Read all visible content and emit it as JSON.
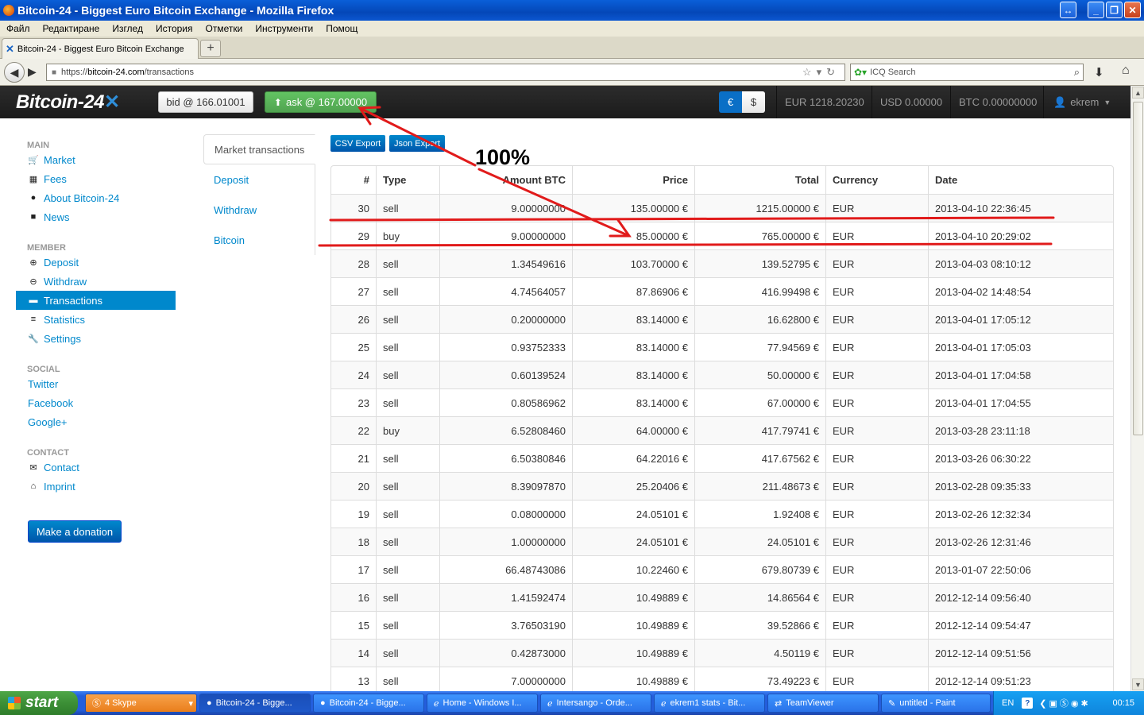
{
  "window": {
    "title": "Bitcoin-24 - Biggest Euro Bitcoin Exchange - Mozilla Firefox"
  },
  "menu": [
    "Файл",
    "Редактиране",
    "Изглед",
    "История",
    "Отметки",
    "Инструменти",
    "Помощ"
  ],
  "browser": {
    "tab_title": "Bitcoin-24 - Biggest Euro Bitcoin Exchange",
    "url_prefix": "https://",
    "url_domain": "bitcoin-24.com",
    "url_path": "/transactions",
    "search_placeholder": "ICQ Search"
  },
  "site": {
    "logo_text": "Bitcoin-24",
    "bid_label": "bid @ 166.01001",
    "ask_label": "ask @ 167.00000",
    "currency_eur": "€",
    "currency_usd": "$",
    "balance_eur": "EUR 1218.20230",
    "balance_usd": "USD 0.00000",
    "balance_btc": "BTC 0.00000000",
    "username": "ekrem"
  },
  "sidebar": {
    "main_header": "MAIN",
    "main_items": [
      "Market",
      "Fees",
      "About Bitcoin-24",
      "News"
    ],
    "member_header": "MEMBER",
    "member_items": [
      "Deposit",
      "Withdraw",
      "Transactions",
      "Statistics",
      "Settings"
    ],
    "social_header": "SOCIAL",
    "social_items": [
      "Twitter",
      "Facebook",
      "Google+"
    ],
    "contact_header": "CONTACT",
    "contact_items": [
      "Contact",
      "Imprint"
    ],
    "donate_label": "Make a donation"
  },
  "subnav": [
    "Market transactions",
    "Deposit",
    "Withdraw",
    "Bitcoin"
  ],
  "exports": {
    "csv": "CSV Export",
    "json": "Json Export"
  },
  "table": {
    "headers": [
      "#",
      "Type",
      "Amount BTC",
      "Price",
      "Total",
      "Currency",
      "Date"
    ],
    "rows": [
      [
        "30",
        "sell",
        "9.00000000",
        "135.00000 €",
        "1215.00000 €",
        "EUR",
        "2013-04-10 22:36:45"
      ],
      [
        "29",
        "buy",
        "9.00000000",
        "85.00000 €",
        "765.00000 €",
        "EUR",
        "2013-04-10 20:29:02"
      ],
      [
        "28",
        "sell",
        "1.34549616",
        "103.70000 €",
        "139.52795 €",
        "EUR",
        "2013-04-03 08:10:12"
      ],
      [
        "27",
        "sell",
        "4.74564057",
        "87.86906 €",
        "416.99498 €",
        "EUR",
        "2013-04-02 14:48:54"
      ],
      [
        "26",
        "sell",
        "0.20000000",
        "83.14000 €",
        "16.62800 €",
        "EUR",
        "2013-04-01 17:05:12"
      ],
      [
        "25",
        "sell",
        "0.93752333",
        "83.14000 €",
        "77.94569 €",
        "EUR",
        "2013-04-01 17:05:03"
      ],
      [
        "24",
        "sell",
        "0.60139524",
        "83.14000 €",
        "50.00000 €",
        "EUR",
        "2013-04-01 17:04:58"
      ],
      [
        "23",
        "sell",
        "0.80586962",
        "83.14000 €",
        "67.00000 €",
        "EUR",
        "2013-04-01 17:04:55"
      ],
      [
        "22",
        "buy",
        "6.52808460",
        "64.00000 €",
        "417.79741 €",
        "EUR",
        "2013-03-28 23:11:18"
      ],
      [
        "21",
        "sell",
        "6.50380846",
        "64.22016 €",
        "417.67562 €",
        "EUR",
        "2013-03-26 06:30:22"
      ],
      [
        "20",
        "sell",
        "8.39097870",
        "25.20406 €",
        "211.48673 €",
        "EUR",
        "2013-02-28 09:35:33"
      ],
      [
        "19",
        "sell",
        "0.08000000",
        "24.05101 €",
        "1.92408 €",
        "EUR",
        "2013-02-26 12:32:34"
      ],
      [
        "18",
        "sell",
        "1.00000000",
        "24.05101 €",
        "24.05101 €",
        "EUR",
        "2013-02-26 12:31:46"
      ],
      [
        "17",
        "sell",
        "66.48743086",
        "10.22460 €",
        "679.80739 €",
        "EUR",
        "2013-01-07 22:50:06"
      ],
      [
        "16",
        "sell",
        "1.41592474",
        "10.49889 €",
        "14.86564 €",
        "EUR",
        "2012-12-14 09:56:40"
      ],
      [
        "15",
        "sell",
        "3.76503190",
        "10.49889 €",
        "39.52866 €",
        "EUR",
        "2012-12-14 09:54:47"
      ],
      [
        "14",
        "sell",
        "0.42873000",
        "10.49889 €",
        "4.50119 €",
        "EUR",
        "2012-12-14 09:51:56"
      ],
      [
        "13",
        "sell",
        "7.00000000",
        "10.49889 €",
        "73.49223 €",
        "EUR",
        "2012-12-14 09:51:23"
      ]
    ]
  },
  "annotation": {
    "label": "100%",
    "color": "#e11b1b"
  },
  "taskbar": {
    "start_label": "start",
    "items": [
      "4 Skype",
      "Bitcoin-24 - Bigge...",
      "Bitcoin-24 - Bigge...",
      "Home - Windows I...",
      "Intersango - Orde...",
      "ekrem1 stats - Bit...",
      "TeamViewer",
      "untitled - Paint"
    ],
    "lang": "EN",
    "clock": "00:15"
  }
}
